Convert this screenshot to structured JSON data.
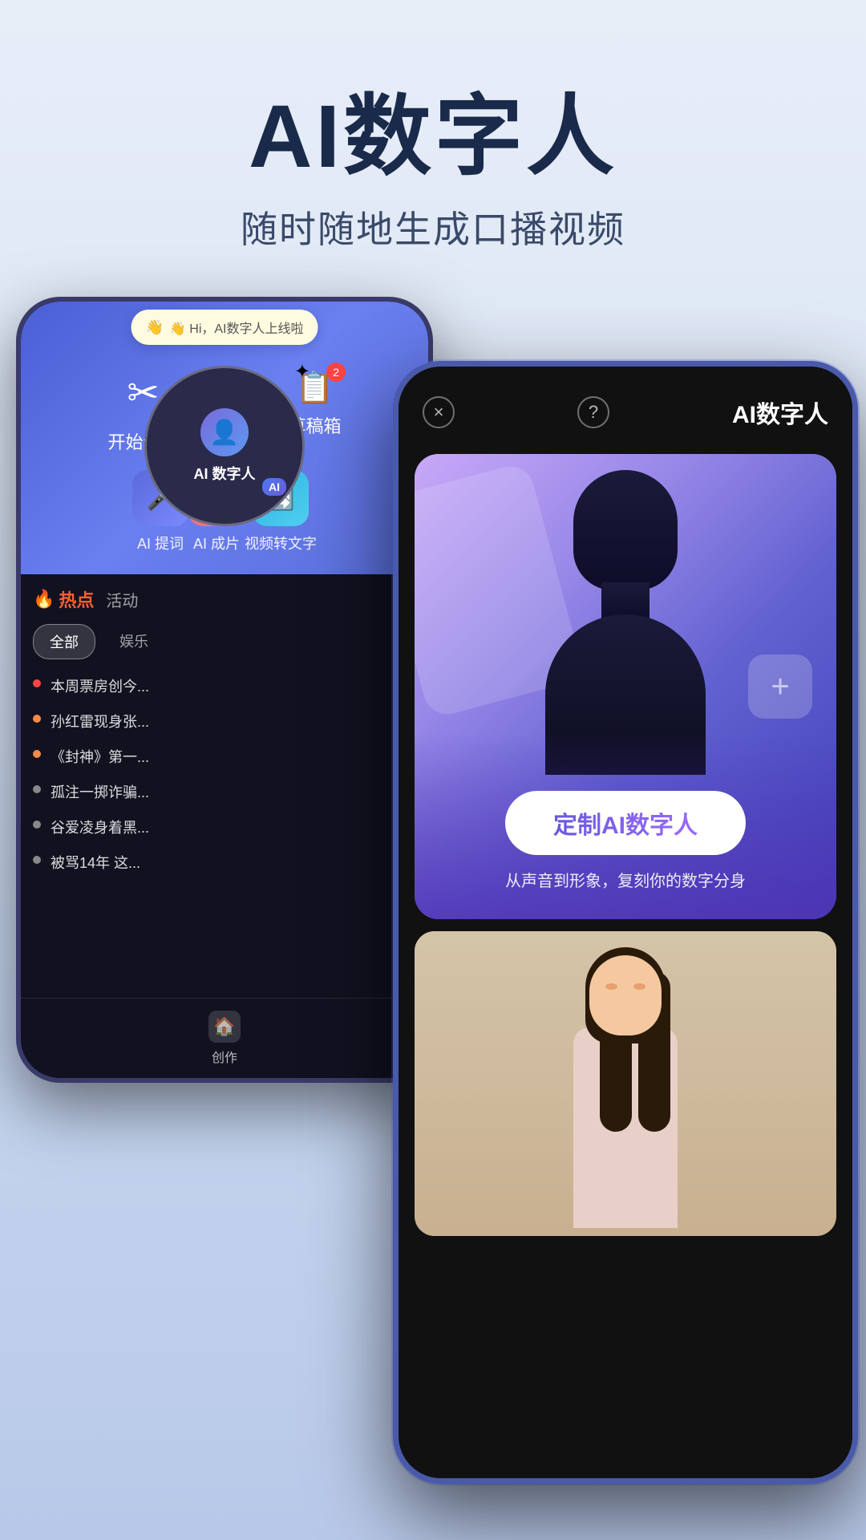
{
  "header": {
    "main_title": "AI数字人",
    "sub_title": "随时随地生成口播视频"
  },
  "back_phone": {
    "topbar": {
      "notification": "👋 Hi，AI数字人上线啦",
      "circle_label": "AI 数字人",
      "items": [
        {
          "icon": "✂",
          "label": "开始创作"
        },
        {
          "icon": "📝",
          "label": "草稿箱",
          "badge": "2"
        }
      ]
    },
    "tools": [
      {
        "label": "AI 提词"
      },
      {
        "label": "AI 成片"
      },
      {
        "label": "视频转文字"
      }
    ],
    "tabs": [
      "热点",
      "活动"
    ],
    "filters": [
      "全部",
      "娱乐"
    ],
    "news": [
      {
        "text": "本周票房创今...",
        "dot_color": "red"
      },
      {
        "text": "孙红雷现身张...",
        "dot_color": "orange"
      },
      {
        "text": "《封神》第一...",
        "dot_color": "orange"
      },
      {
        "text": "孤注一掷诈骗...",
        "dot_color": "gray"
      },
      {
        "text": "谷爱凌身着黑...",
        "dot_color": "gray"
      },
      {
        "text": "被骂14年 这...",
        "dot_color": "gray"
      }
    ],
    "bottom_nav_label": "创作"
  },
  "front_phone": {
    "header": {
      "title": "AI数字人",
      "close_icon": "×",
      "help_icon": "?"
    },
    "digital_card": {
      "customize_btn": "定制AI数字人",
      "customize_subtitle": "从声音到形象，复刻你的数字分身",
      "plus_icon": "+"
    },
    "sparkle_icon": "✦"
  },
  "colors": {
    "bg_gradient_start": "#e8eef8",
    "bg_gradient_end": "#b8c8e8",
    "accent_blue": "#5a6adb",
    "accent_purple": "#7a5adb",
    "phone_bg": "#1a1a2e",
    "hot_red": "#ff6030"
  }
}
